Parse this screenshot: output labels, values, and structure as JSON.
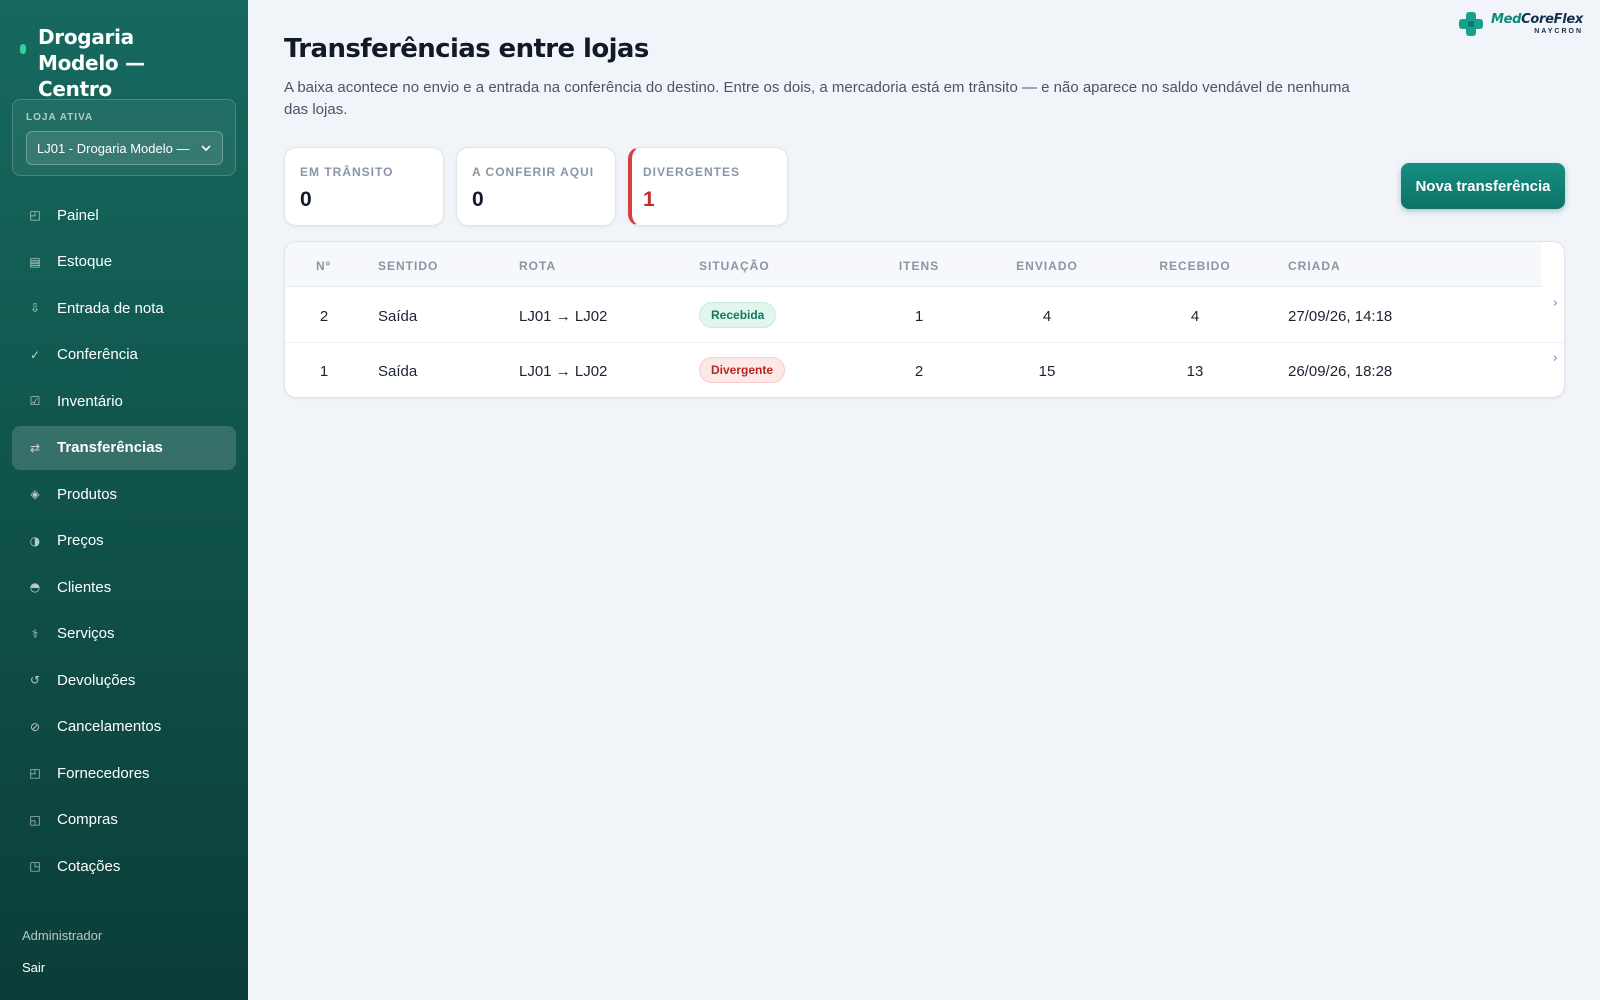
{
  "sidebar": {
    "brand_title": "Drogaria Modelo — Centro",
    "store_label": "LOJA ATIVA",
    "store_value": "LJ01 - Drogaria Modelo —",
    "items": [
      {
        "label": "Painel",
        "icon": "◰"
      },
      {
        "label": "Estoque",
        "icon": "▤"
      },
      {
        "label": "Entrada de nota",
        "icon": "⇩"
      },
      {
        "label": "Conferência",
        "icon": "✓"
      },
      {
        "label": "Inventário",
        "icon": "☑"
      },
      {
        "label": "Transferências",
        "icon": "⇄"
      },
      {
        "label": "Produtos",
        "icon": "◈"
      },
      {
        "label": "Preços",
        "icon": "◑"
      },
      {
        "label": "Clientes",
        "icon": "◓"
      },
      {
        "label": "Serviços",
        "icon": "⚕"
      },
      {
        "label": "Devoluções",
        "icon": "↺"
      },
      {
        "label": "Cancelamentos",
        "icon": "⊘"
      },
      {
        "label": "Fornecedores",
        "icon": "◰"
      },
      {
        "label": "Compras",
        "icon": "◱"
      },
      {
        "label": "Cotações",
        "icon": "◳"
      }
    ],
    "active_item": "Transferências",
    "user": "Administrador",
    "logout": "Sair"
  },
  "logo": {
    "name_a": "Med",
    "name_b": "CoreFlex",
    "sub": "NAYCRON"
  },
  "page": {
    "title": "Transferências entre lojas",
    "description": "A baixa acontece no envio e a entrada na conferência do destino. Entre os dois, a mercadoria está em trânsito — e não aparece no saldo vendável de nenhuma das lojas."
  },
  "stats": [
    {
      "label": "EM TRÂNSITO",
      "value": "0"
    },
    {
      "label": "A CONFERIR AQUI",
      "value": "0"
    },
    {
      "label": "DIVERGENTES",
      "value": "1"
    }
  ],
  "new_button": "Nova transferência",
  "table": {
    "headers": [
      "Nº",
      "SENTIDO",
      "ROTA",
      "SITUAÇÃO",
      "ITENS",
      "ENVIADO",
      "RECEBIDO",
      "CRIADA"
    ],
    "rows": [
      {
        "num": "2",
        "direction": "Saída",
        "route": "LJ01 → LJ02",
        "status": "Recebida",
        "items": "1",
        "sent": "4",
        "received": "4",
        "created": "27/09/26, 14:18"
      },
      {
        "num": "1",
        "direction": "Saída",
        "route": "LJ01 → LJ02",
        "status": "Divergente",
        "items": "2",
        "sent": "15",
        "received": "13",
        "created": "26/09/26, 18:28"
      }
    ]
  },
  "colors": {
    "sidebar": "#0f5149",
    "accent": "#0d7267",
    "ok": "#12775f",
    "danger": "#c42b2b"
  }
}
